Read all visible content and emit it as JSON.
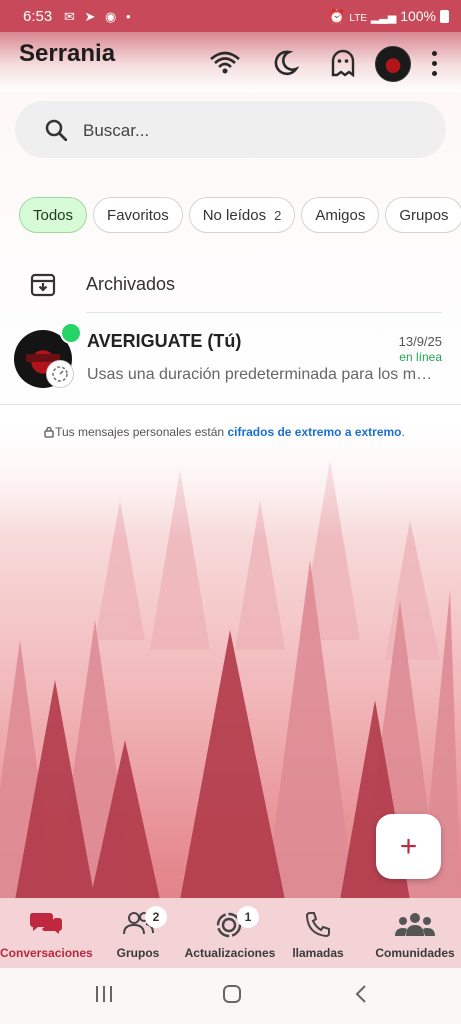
{
  "status_bar": {
    "time": "6:53",
    "network": "LTE",
    "battery": "100%"
  },
  "app": {
    "title": "Serrania"
  },
  "search": {
    "placeholder": "Buscar..."
  },
  "filters": [
    {
      "label": "Todos",
      "count": ""
    },
    {
      "label": "Favoritos",
      "count": ""
    },
    {
      "label": "No leídos",
      "count": "2"
    },
    {
      "label": "Amigos",
      "count": ""
    },
    {
      "label": "Grupos",
      "count": ""
    }
  ],
  "archived": {
    "label": "Archivados"
  },
  "chats": [
    {
      "name": "AVERIGUATE (Tú)",
      "date": "13/9/25",
      "presence": "en línea",
      "preview": "Usas una duración predeterminada para los me..."
    }
  ],
  "encryption": {
    "text": "Tus mensajes personales están ",
    "link": "cifrados de extremo a extremo",
    "suffix": "."
  },
  "fab": {
    "label": "+"
  },
  "bottom_nav": [
    {
      "label": "Conversaciones",
      "badge": ""
    },
    {
      "label": "Grupos",
      "badge": "2"
    },
    {
      "label": "Actualizaciones",
      "badge": "1"
    },
    {
      "label": "llamadas",
      "badge": ""
    },
    {
      "label": "Comunidades",
      "badge": ""
    }
  ],
  "colors": {
    "accent": "#b8283e",
    "online": "#25d366",
    "active_chip": "#d8fbd7",
    "link": "#1a6fd0"
  }
}
